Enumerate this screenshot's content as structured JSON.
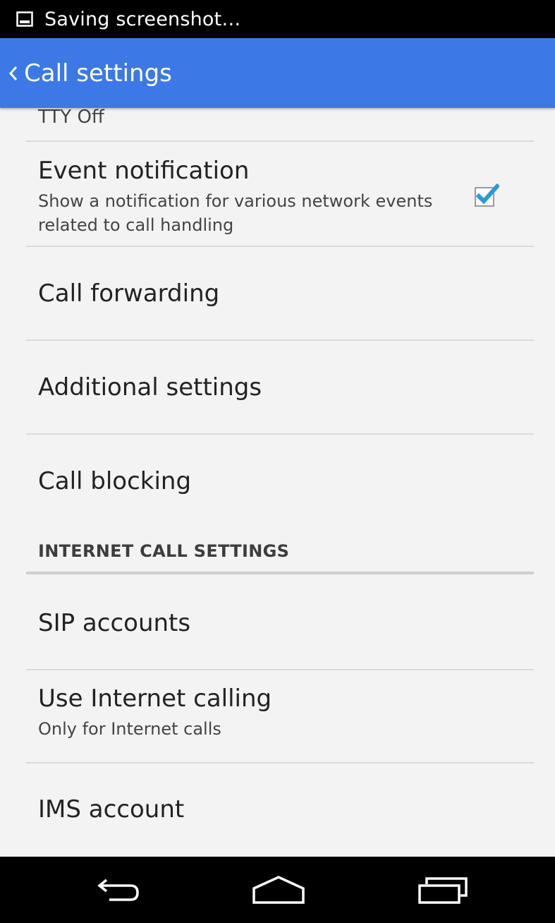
{
  "status_bar": {
    "notification_icon": "image-icon",
    "text": "Saving screenshot…"
  },
  "action_bar": {
    "back_icon": "chevron-left-icon",
    "title": "Call settings",
    "color": "#3c79e6"
  },
  "list": {
    "clipped_item_summary": "TTY Off",
    "event_notification": {
      "title": "Event notification",
      "summary": "Show a notification for various network events related to call handling",
      "checked": true,
      "check_color": "#2a9bd6"
    },
    "call_forwarding": {
      "title": "Call forwarding"
    },
    "additional_settings": {
      "title": "Additional settings"
    },
    "call_blocking": {
      "title": "Call blocking"
    },
    "internet_section_header": "INTERNET CALL SETTINGS",
    "sip_accounts": {
      "title": "SIP accounts"
    },
    "use_internet_calling": {
      "title": "Use Internet calling",
      "summary": "Only for Internet calls"
    },
    "ims_account": {
      "title": "IMS account"
    }
  },
  "nav_bar": {
    "back": "back-icon",
    "home": "home-icon",
    "recents": "recent-apps-icon"
  }
}
